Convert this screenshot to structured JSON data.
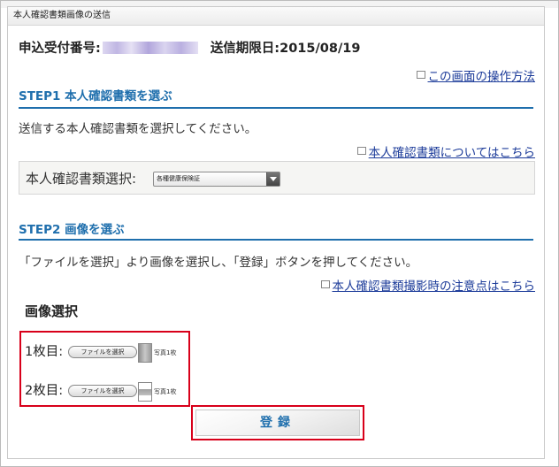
{
  "panel": {
    "title": "本人確認書類画像の送信"
  },
  "receipt": {
    "number_label": "申込受付番号:",
    "deadline": "送信期限日:2015/08/19"
  },
  "links": {
    "operation": "この画面の操作方法",
    "about_docs": "本人確認書類についてはこちら",
    "photo_notes": "本人確認書類撮影時の注意点はこちら"
  },
  "step1": {
    "heading": "STEP1 本人確認書類を選ぶ",
    "description": "送信する本人確認書類を選択してください。",
    "select_label": "本人確認書類選択:",
    "select_value": "各種健康保険証"
  },
  "step2": {
    "heading": "STEP2 画像を選ぶ",
    "description": "「ファイルを選択」より画像を選択し、「登録」ボタンを押してください。",
    "section_title": "画像選択",
    "rows": [
      {
        "label": "1枚目:",
        "button": "ファイルを選択",
        "caption": "写真1枚"
      },
      {
        "label": "2枚目:",
        "button": "ファイルを選択",
        "caption": "写真1枚"
      }
    ]
  },
  "register_button": "登録",
  "colors": {
    "accent": "#1f6fad",
    "highlight": "#d8001a",
    "link": "#1d3c9a"
  },
  "icons": {
    "link": "external-link-icon",
    "select": "dropdown-arrow-icon"
  }
}
